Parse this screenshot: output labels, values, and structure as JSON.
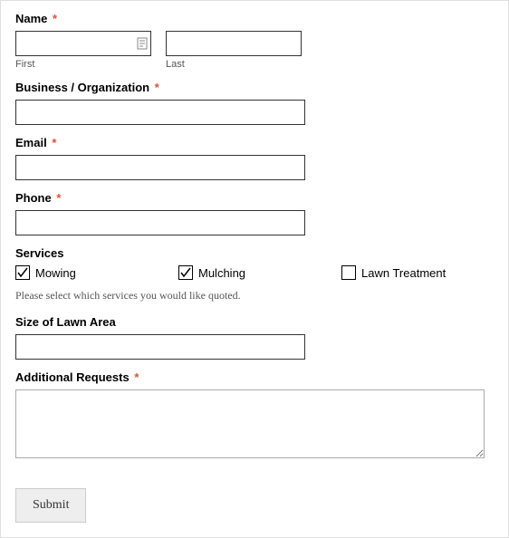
{
  "fields": {
    "name": {
      "label": "Name",
      "required": true,
      "first": {
        "value": "",
        "sublabel": "First"
      },
      "last": {
        "value": "",
        "sublabel": "Last"
      }
    },
    "business": {
      "label": "Business / Organization",
      "required": true,
      "value": ""
    },
    "email": {
      "label": "Email",
      "required": true,
      "value": ""
    },
    "phone": {
      "label": "Phone",
      "required": true,
      "value": ""
    },
    "services": {
      "label": "Services",
      "options": [
        {
          "label": "Mowing",
          "checked": true
        },
        {
          "label": "Mulching",
          "checked": true
        },
        {
          "label": "Lawn Treatment",
          "checked": false
        }
      ],
      "hint": "Please select which services you would like quoted."
    },
    "lawn_size": {
      "label": "Size of Lawn Area",
      "required": false,
      "value": ""
    },
    "additional": {
      "label": "Additional Requests",
      "required": true,
      "value": ""
    }
  },
  "submit_label": "Submit",
  "required_marker": "*"
}
